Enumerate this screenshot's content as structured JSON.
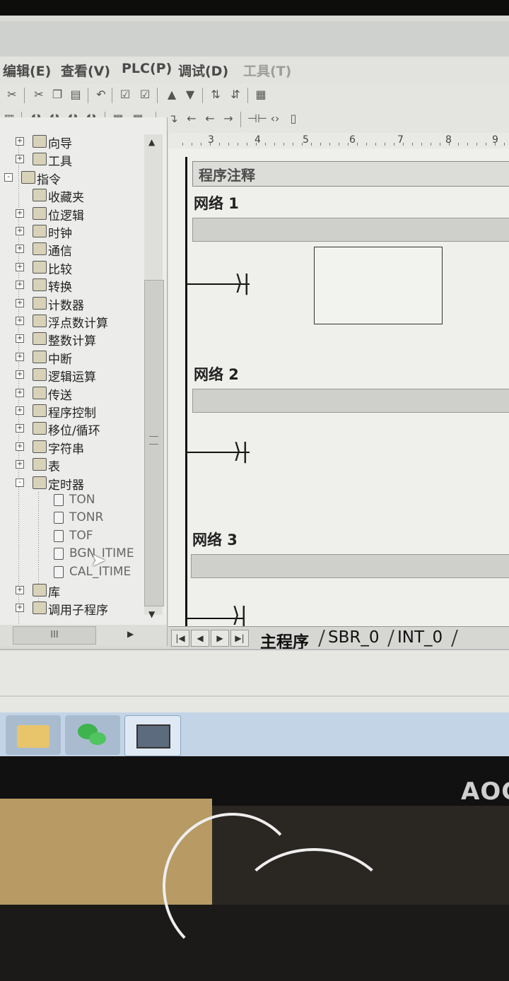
{
  "window": {
    "title": ""
  },
  "menu": [
    "编辑(E)",
    "查看(V)",
    "PLC(P)",
    "调试(D)",
    "工具(T)"
  ],
  "toolbar1": [
    "scissors-icon",
    "copy-icon",
    "paste-icon",
    "undo-icon",
    "compile-icon",
    "compile-all-icon",
    "upload-icon",
    "download-icon",
    "sort-asc-icon",
    "sort-desc-icon",
    "block-icon"
  ],
  "toolbar2": [
    "ladder-icon",
    "contact-icon",
    "coil-icon",
    "box-icon",
    "network-insert-icon",
    "network-delete-icon",
    "line-down-icon",
    "line-left-icon",
    "line-right-icon",
    "contact-insert-icon",
    "coil-insert-icon",
    "box-insert-icon"
  ],
  "tree": {
    "items": [
      {
        "label": "向导",
        "level": 1,
        "expander": "+"
      },
      {
        "label": "工具",
        "level": 1,
        "expander": "+"
      },
      {
        "label": "指令",
        "level": 0,
        "expander": "-"
      },
      {
        "label": "收藏夹",
        "level": 1,
        "expander": ""
      },
      {
        "label": "位逻辑",
        "level": 1,
        "expander": "+"
      },
      {
        "label": "时钟",
        "level": 1,
        "expander": "+"
      },
      {
        "label": "通信",
        "level": 1,
        "expander": "+"
      },
      {
        "label": "比较",
        "level": 1,
        "expander": "+"
      },
      {
        "label": "转换",
        "level": 1,
        "expander": "+"
      },
      {
        "label": "计数器",
        "level": 1,
        "expander": "+"
      },
      {
        "label": "浮点数计算",
        "level": 1,
        "expander": "+"
      },
      {
        "label": "整数计算",
        "level": 1,
        "expander": "+"
      },
      {
        "label": "中断",
        "level": 1,
        "expander": "+"
      },
      {
        "label": "逻辑运算",
        "level": 1,
        "expander": "+"
      },
      {
        "label": "传送",
        "level": 1,
        "expander": "+"
      },
      {
        "label": "程序控制",
        "level": 1,
        "expander": "+"
      },
      {
        "label": "移位/循环",
        "level": 1,
        "expander": "+"
      },
      {
        "label": "字符串",
        "level": 1,
        "expander": "+"
      },
      {
        "label": "表",
        "level": 1,
        "expander": "+"
      },
      {
        "label": "定时器",
        "level": 1,
        "expander": "-"
      },
      {
        "label": "TON",
        "level": 2,
        "expander": ""
      },
      {
        "label": "TONR",
        "level": 2,
        "expander": ""
      },
      {
        "label": "TOF",
        "level": 2,
        "expander": ""
      },
      {
        "label": "BGN_ITIME",
        "level": 2,
        "expander": ""
      },
      {
        "label": "CAL_ITIME",
        "level": 2,
        "expander": ""
      },
      {
        "label": "库",
        "level": 1,
        "expander": "+"
      },
      {
        "label": "调用子程序",
        "level": 1,
        "expander": "+"
      }
    ],
    "hscroll_grip": "III"
  },
  "ruler": [
    "3",
    "4",
    "5",
    "6",
    "7",
    "8",
    "9"
  ],
  "editor": {
    "program_comment": "程序注释",
    "networks": [
      {
        "title": "网络 1"
      },
      {
        "title": "网络 2"
      },
      {
        "title": "网络 3"
      }
    ]
  },
  "tabs": [
    "主程序",
    "SBR_0",
    "INT_0"
  ],
  "taskbar": [
    "explorer-icon",
    "wechat-icon",
    "step7-microwin-icon"
  ],
  "monitor": {
    "brand": "AOC"
  }
}
